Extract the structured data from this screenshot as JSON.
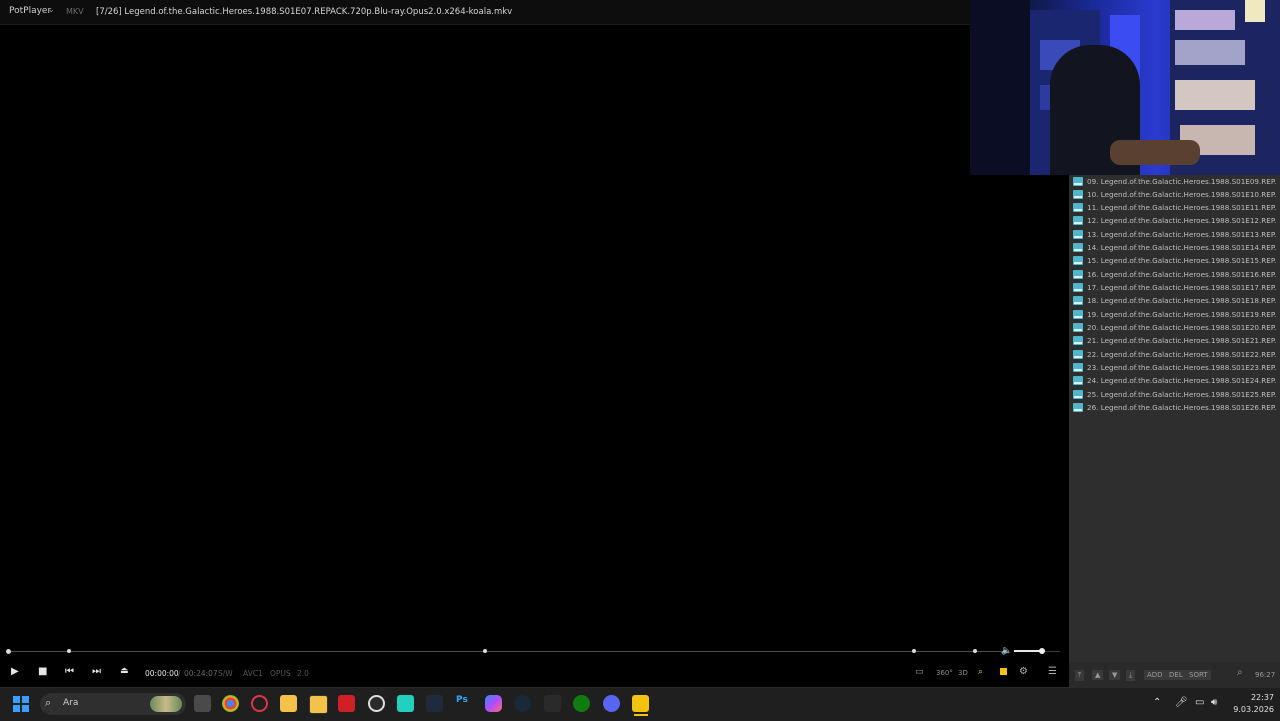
{
  "title_bar": {
    "app_name": "PotPlayer",
    "format": "MKV",
    "file_title": "[7/26] Legend.of.the.Galactic.Heroes.1988.S01E07.REPACK.720p.Blu-ray.Opus2.0.x264-koala.mkv"
  },
  "playlist": {
    "items": [
      "09. Legend.of.the.Galactic.Heroes.1988.S01E09.REP...",
      "10. Legend.of.the.Galactic.Heroes.1988.S01E10.REP...",
      "11. Legend.of.the.Galactic.Heroes.1988.S01E11.REP...",
      "12. Legend.of.the.Galactic.Heroes.1988.S01E12.REP...",
      "13. Legend.of.the.Galactic.Heroes.1988.S01E13.REP...",
      "14. Legend.of.the.Galactic.Heroes.1988.S01E14.REP...",
      "15. Legend.of.the.Galactic.Heroes.1988.S01E15.REP...",
      "16. Legend.of.the.Galactic.Heroes.1988.S01E16.REP...",
      "17. Legend.of.the.Galactic.Heroes.1988.S01E17.REP...",
      "18. Legend.of.the.Galactic.Heroes.1988.S01E18.REP...",
      "19. Legend.of.the.Galactic.Heroes.1988.S01E19.REP...",
      "20. Legend.of.the.Galactic.Heroes.1988.S01E20.REP...",
      "21. Legend.of.the.Galactic.Heroes.1988.S01E21.REP...",
      "22. Legend.of.the.Galactic.Heroes.1988.S01E22.REP...",
      "23. Legend.of.the.Galactic.Heroes.1988.S01E23.REP...",
      "24. Legend.of.the.Galactic.Heroes.1988.S01E24.REP...",
      "25. Legend.of.the.Galactic.Heroes.1988.S01E25.REP...",
      "26. Legend.of.the.Galactic.Heroes.1988.S01E26.REP..."
    ],
    "footer": {
      "add": "ADD",
      "del": "DEL",
      "sort": "SORT",
      "total": "96:27"
    }
  },
  "player": {
    "current_time": "00:00:00",
    "separator": "/",
    "total_time": "00:24:07",
    "decoder": "S/W",
    "video_codec": "AVC1",
    "audio_codec": "OPUS",
    "channels": "2.0",
    "seek_position": 0.0,
    "volume": 0.6,
    "toggle_360": "360°",
    "toggle_3d": "3D"
  },
  "taskbar": {
    "search_placeholder": "Ara",
    "time": "22:37",
    "date": "9.03.2026",
    "pinned_apps": [
      "file-manager",
      "chrome",
      "opera",
      "explorer",
      "store",
      "netflix",
      "obs",
      "screen-recorder",
      "app",
      "photoshop",
      "copilot",
      "steam",
      "epic-games",
      "xbox",
      "discord",
      "potplayer"
    ]
  },
  "colors": {
    "accent_taskbar_active": "#f2c40f",
    "playlist_bg": "#2e2e2e",
    "webcam_blue": "#2a3bd0"
  }
}
